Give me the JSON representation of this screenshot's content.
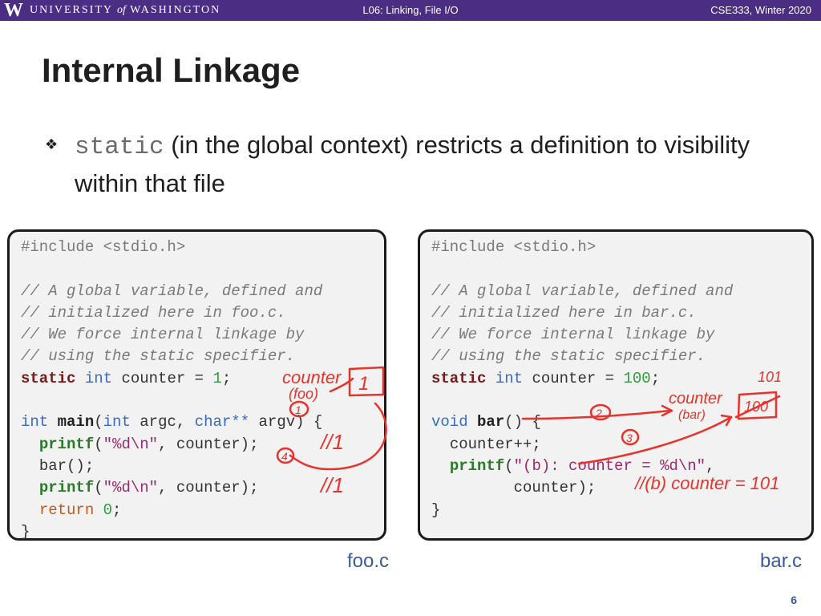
{
  "header": {
    "logo_mark": "W",
    "university_name_a": "UNIVERSITY",
    "university_name_of": "of",
    "university_name_b": "WASHINGTON",
    "lecture": "L06:  Linking, File I/O",
    "course": "CSE333, Winter 2020",
    "bar_color": "#4b2e83"
  },
  "slide": {
    "title": "Internal Linkage",
    "bullet_keyword": "static",
    "bullet_text": " (in the global context) restricts a definition to visibility within that file",
    "bullet_icon": "diamond-bullet-icon",
    "page_number": "6"
  },
  "foo_file": {
    "label": "foo.c",
    "lines": {
      "include_kw": "#include",
      "include_hdr": " <stdio.h>",
      "cm1": "// A global variable, defined and",
      "cm2": "// initialized here in foo.c.",
      "cm3": "// We force internal linkage by",
      "cm4": "// using the static specifier.",
      "decl_static": "static",
      "decl_int": "int",
      "decl_rest": " counter = ",
      "decl_value": "1",
      "decl_end": ";",
      "main_int": "int",
      "main_name": "main",
      "main_open": "(",
      "main_int2": "int",
      "main_argc": " argc, ",
      "main_char": "char**",
      "main_rest": " argv) {",
      "printf1_fn": "printf",
      "printf1_open": "(",
      "printf1_str": "\"%d\\n\"",
      "printf1_rest": ", counter);",
      "bar_call": "bar();",
      "printf2_fn": "printf",
      "printf2_open": "(",
      "printf2_str": "\"%d\\n\"",
      "printf2_rest": ", counter);",
      "return_kw": "return",
      "return_val": "0",
      "return_end": ";",
      "close": "}"
    }
  },
  "bar_file": {
    "label": "bar.c",
    "lines": {
      "include_kw": "#include",
      "include_hdr": " <stdio.h>",
      "cm1": "// A global variable, defined and",
      "cm2": "// initialized here in bar.c.",
      "cm3": "// We force internal linkage by",
      "cm4": "// using the static specifier.",
      "decl_static": "static",
      "decl_int": "int",
      "decl_rest": " counter = ",
      "decl_value": "100",
      "decl_end": ";",
      "fn_void": "void",
      "fn_name": "bar",
      "fn_rest": "() {",
      "incr": "counter++;",
      "printf_fn": "printf",
      "printf_open": "(",
      "printf_str": "\"(b): counter = %d\\n\"",
      "printf_comma": ",",
      "printf_cont": "counter);",
      "close": "}"
    }
  },
  "annotations": {
    "foo_counter": "counter",
    "foo_scope": "(foo)",
    "foo_value": "1",
    "step1": "1",
    "step2": "2",
    "step3": "3",
    "step4": "4",
    "out1": "//1",
    "out2": "//1",
    "bar_101": "101",
    "bar_counter": "counter",
    "bar_scope": "(bar)",
    "bar_box_value": "100",
    "bar_out": "//(b) counter = 101",
    "ink_color": "#e8332c"
  }
}
